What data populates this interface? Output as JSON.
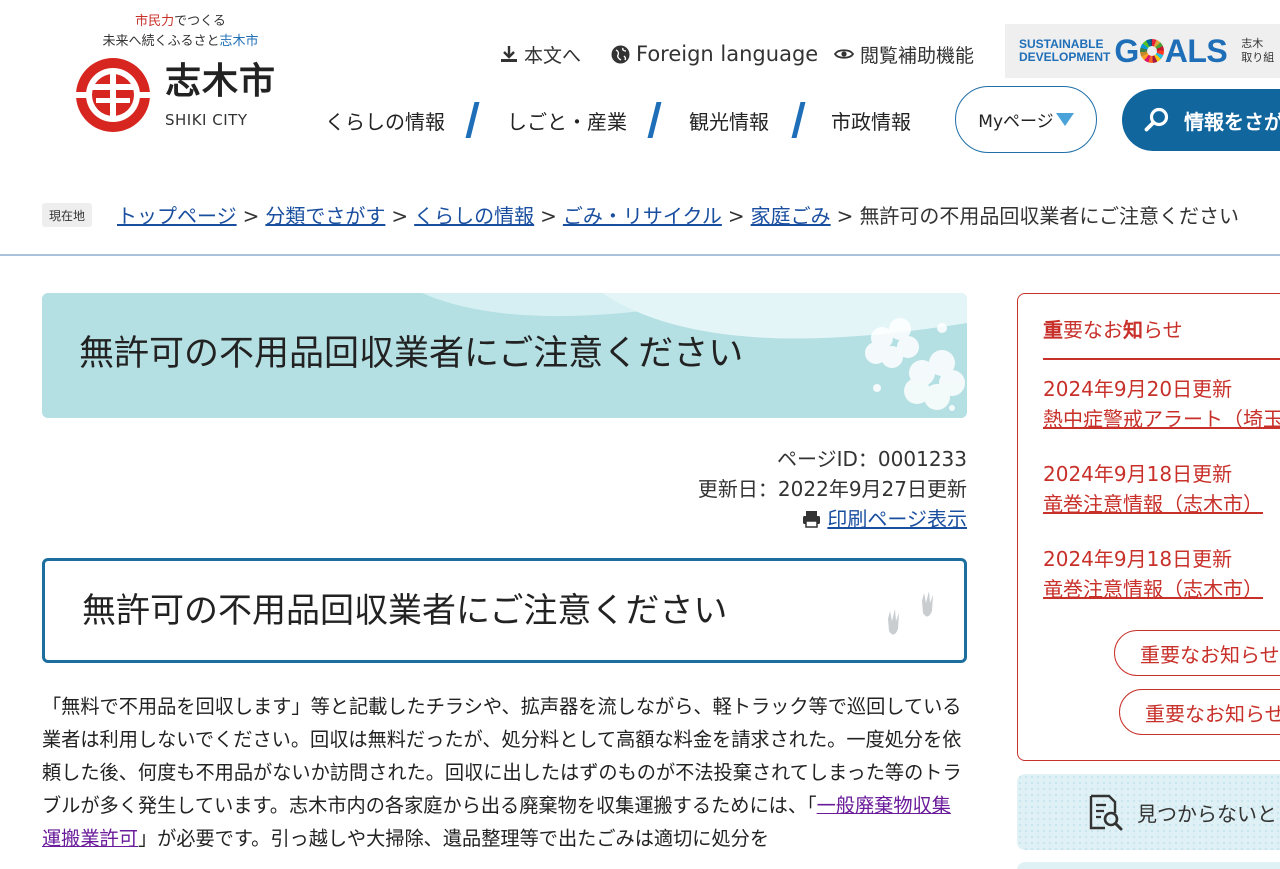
{
  "header": {
    "tagline": {
      "part1": "市民力",
      "part2": "でつくる",
      "part3": "未来へ続くふるさと",
      "part4": "志木市"
    },
    "logo_ja": "志木市",
    "logo_en": "SHIKI CITY",
    "util": {
      "honbun": "本文へ",
      "foreign": "Foreign language",
      "etsuran": "閲覧補助機能"
    },
    "sdgs": {
      "line1": "SUSTAINABLE",
      "line2": "DEVELOPMENT",
      "goals_g": "G",
      "goals_rest": "ALS",
      "side1": "志木",
      "side2": "取り組"
    },
    "nav": [
      "くらしの情報",
      "しごと・産業",
      "観光情報",
      "市政情報"
    ],
    "mypage": "Myページ",
    "search": "情報をさがす"
  },
  "breadcrumb": {
    "current_label": "現在地",
    "links": [
      "トップページ",
      "分類でさがす",
      "くらしの情報",
      "ごみ・リサイクル",
      "家庭ごみ"
    ],
    "current": "無許可の不用品回収業者にご注意ください",
    "sep": ">"
  },
  "main": {
    "title": "無許可の不用品回収業者にご注意ください",
    "page_id": "ページID：0001233",
    "updated": "更新日：2022年9月27日更新",
    "print_label": "印刷ページ表示",
    "h2": "無許可の不用品回収業者にご注意ください",
    "para_before_link": "「無料で不用品を回収します」等と記載したチラシや、拡声器を流しながら、軽トラック等で巡回している業者は利用しないでください。回収は無料だったが、処分料として高額な料金を請求された。一度処分を依頼した後、何度も不用品がないか訪問された。回収に出したはずのものが不法投棄されてしまった等のトラブルが多く発生しています。志木市内の各家庭から出る廃棄物を収集運搬するためには、「",
    "para_link": "一般廃棄物収集運搬業許可",
    "para_after_link": "」が必要です。引っ越しや大掃除、遺品整理等で出たごみは適切に処分を"
  },
  "sidebar": {
    "notice_title_1": "重",
    "notice_title_2": "要なお",
    "notice_title_3": "知",
    "notice_title_4": "らせ",
    "items": [
      {
        "date": "2024年9月20日更新",
        "title": "熱中症警戒アラート（埼玉"
      },
      {
        "date": "2024年9月18日更新",
        "title": "竜巻注意情報（志木市）"
      },
      {
        "date": "2024年9月18日更新",
        "title": "竜巻注意情報（志木市）"
      }
    ],
    "buttons": [
      "重要なお知らせ",
      "重要なお知らせ"
    ],
    "notfound": "見つからないとき"
  },
  "colors": {
    "accent": "#1f6fb8",
    "notice": "#c8302a",
    "banner": "#b4dfe3",
    "search_btn": "#11669e"
  }
}
